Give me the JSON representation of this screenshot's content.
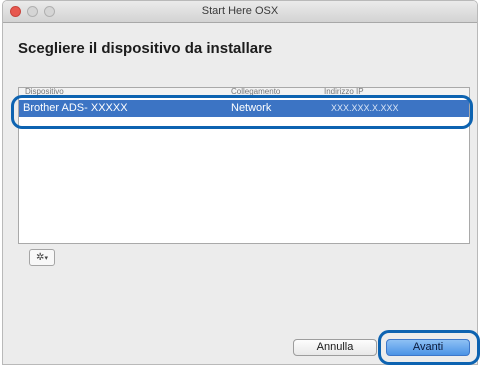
{
  "window": {
    "title": "Start Here OSX"
  },
  "heading": "Scegliere il dispositivo da installare",
  "table": {
    "columns": [
      "Dispositivo",
      "Collegamento",
      "Indirizzo IP"
    ],
    "rows": [
      {
        "device": "Brother ADS- XXXXX",
        "connection": "Network",
        "ip": "XXX.XXX.X.XXX",
        "selected": true
      }
    ]
  },
  "gear_button": {
    "icon": "gear-icon",
    "symbol": "✲",
    "arrow": "▾"
  },
  "buttons": {
    "cancel": "Annulla",
    "next": "Avanti"
  },
  "colors": {
    "selection": "#3c74c4",
    "highlight_ring": "#0d63b1",
    "default_button": "#4c93e6"
  }
}
